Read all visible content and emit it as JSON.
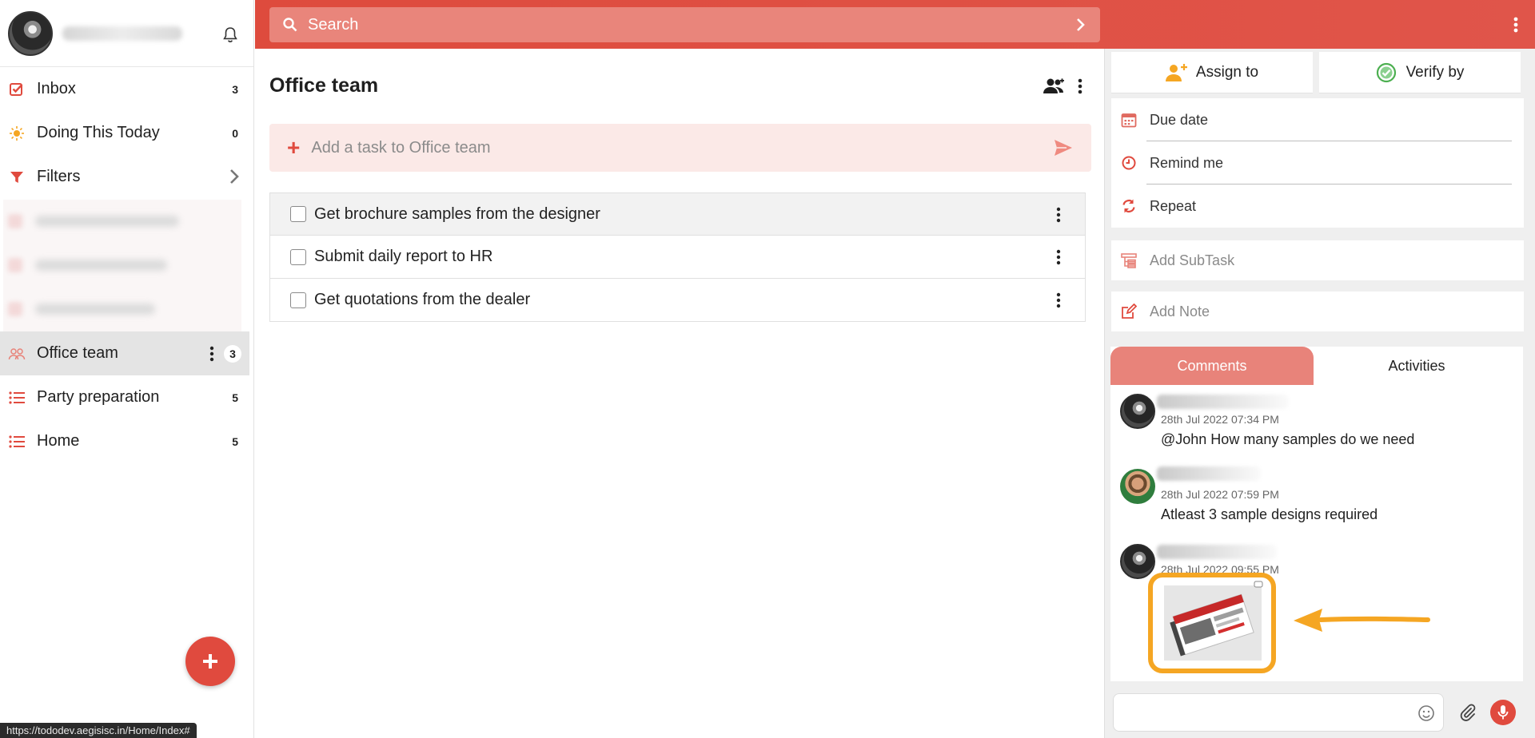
{
  "sidebar": {
    "items": [
      {
        "label": "Inbox",
        "count": "3",
        "icon": "checkbox-icon"
      },
      {
        "label": "Doing This Today",
        "count": "0",
        "icon": "sun-icon"
      },
      {
        "label": "Filters",
        "count": "",
        "icon": "filter-icon"
      },
      {
        "label": "Office team",
        "count": "3",
        "icon": "group-icon"
      },
      {
        "label": "Party preparation",
        "count": "5",
        "icon": "list-icon"
      },
      {
        "label": "Home",
        "count": "5",
        "icon": "list-icon"
      }
    ],
    "status_url": "https://tododev.aegisisc.in/Home/Index#"
  },
  "search": {
    "placeholder": "Search"
  },
  "list": {
    "title": "Office team",
    "add_placeholder": "Add a task to Office team",
    "tasks": [
      {
        "title": "Get brochure samples from the designer"
      },
      {
        "title": "Submit daily report to HR"
      },
      {
        "title": "Get quotations from the dealer"
      }
    ]
  },
  "detail": {
    "assign_label": "Assign to",
    "verify_label": "Verify by",
    "due_label": "Due date",
    "remind_label": "Remind me",
    "repeat_label": "Repeat",
    "subtask_label": "Add SubTask",
    "note_label": "Add Note",
    "tabs": {
      "comments": "Comments",
      "activities": "Activities"
    },
    "comments": [
      {
        "time": "28th Jul 2022 07:34 PM",
        "text": "@John How many samples do we need"
      },
      {
        "time": "28th Jul 2022 07:59 PM",
        "text": "Atleast 3 sample designs required"
      },
      {
        "time": "28th Jul 2022 09:55 PM",
        "text": ""
      }
    ]
  },
  "colors": {
    "accent": "#e04a3e",
    "accent_light": "#e8837a",
    "highlight": "#f5a623"
  }
}
